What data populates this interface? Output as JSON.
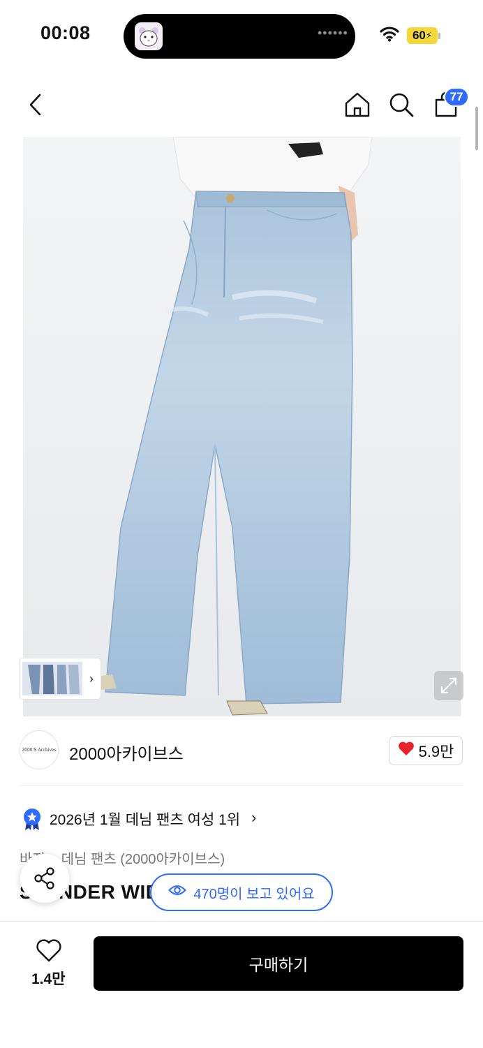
{
  "status_bar": {
    "time": "00:08",
    "battery": "60"
  },
  "header": {
    "cart_count": "77"
  },
  "brand": {
    "name": "2000아카이브스",
    "logo_text": "2000'S Archives",
    "likes": "5.9만"
  },
  "ranking": {
    "text": "2026년 1월 데님 팬츠 여성 1위"
  },
  "breadcrumb": {
    "text": "바지 > 데님 팬츠 (2000아카이브스)"
  },
  "product": {
    "title": "SLENDER WIDE"
  },
  "viewers": {
    "text": "470명이 보고 있어요"
  },
  "bottom_bar": {
    "wish_count": "1.4만",
    "buy_label": "구매하기"
  },
  "colors": {
    "accent": "#2f6bff",
    "heart": "#e8222b",
    "battery": "#f4d83a",
    "buy_bg": "#000000"
  },
  "icons": [
    "back-icon",
    "home-icon",
    "search-icon",
    "cart-icon",
    "expand-icon",
    "heart-icon",
    "star-badge-icon",
    "share-icon",
    "eye-icon",
    "wifi-icon"
  ]
}
